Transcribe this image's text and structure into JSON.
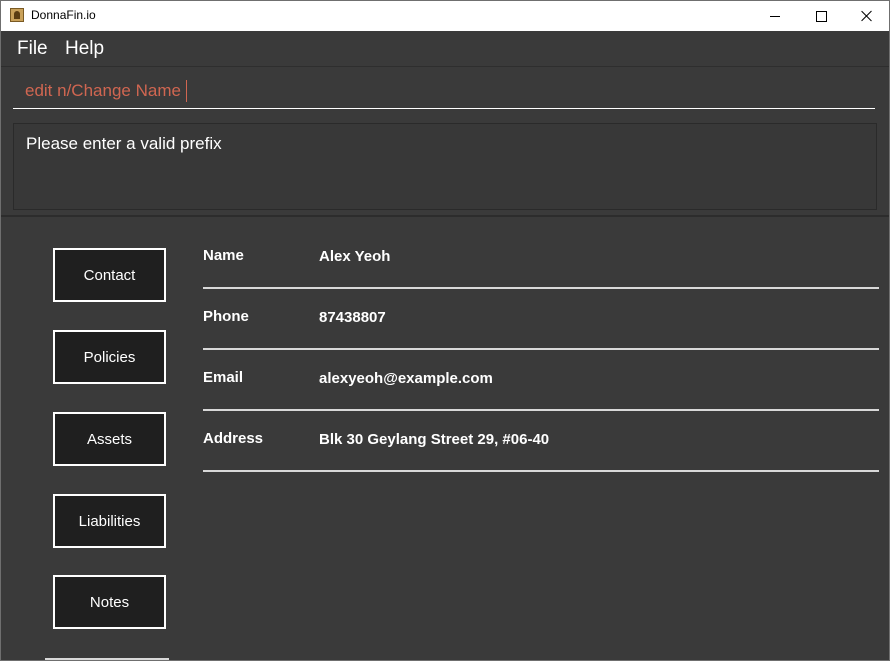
{
  "window": {
    "title": "DonnaFin.io",
    "icon": "app-icon"
  },
  "menu": {
    "items": [
      {
        "label": "File"
      },
      {
        "label": "Help"
      }
    ]
  },
  "command": {
    "value": "edit n/Change Name",
    "color": "#d06651"
  },
  "result": {
    "text": "Please enter a valid prefix"
  },
  "nav": {
    "buttons": [
      {
        "label": "Contact"
      },
      {
        "label": "Policies"
      },
      {
        "label": "Assets"
      },
      {
        "label": "Liabilities"
      },
      {
        "label": "Notes"
      }
    ]
  },
  "details": {
    "rows": [
      {
        "label": "Name",
        "value": "Alex Yeoh"
      },
      {
        "label": "Phone",
        "value": "87438807"
      },
      {
        "label": "Email",
        "value": "alexyeoh@example.com"
      },
      {
        "label": "Address",
        "value": "Blk 30 Geylang Street 29, #06-40"
      }
    ]
  },
  "colors": {
    "background": "#3a3a3a",
    "button_bg": "#1f1f1f",
    "accent_text": "#d06651"
  }
}
